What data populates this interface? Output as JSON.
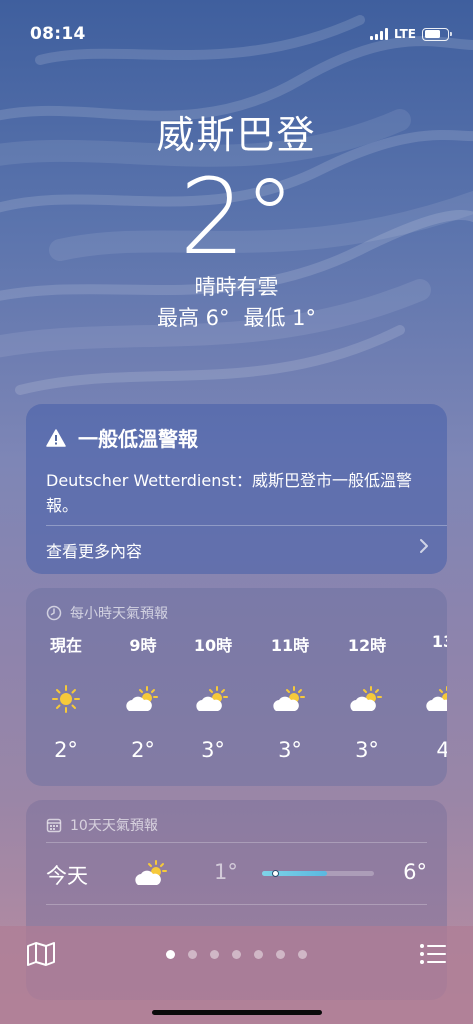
{
  "status_bar": {
    "time": "08:14",
    "network": "LTE",
    "battery_level": 0.7
  },
  "location": {
    "city": "威斯巴登",
    "temperature": "2°",
    "condition": "晴時有雲",
    "high": "最高 6°",
    "low": "最低 1°"
  },
  "alert": {
    "icon": "warning-icon",
    "title": "一般低溫警報",
    "body": "Deutscher Wetterdienst：威斯巴登市一般低溫警報。",
    "more_label": "查看更多內容"
  },
  "hourly": {
    "header": "每小時天氣預報",
    "icon": "clock-icon",
    "items": [
      {
        "time": "現在",
        "icon": "sun-icon",
        "temp": "2°"
      },
      {
        "time": "9時",
        "icon": "partly-cloudy-icon",
        "temp": "2°"
      },
      {
        "time": "10時",
        "icon": "partly-cloudy-icon",
        "temp": "3°"
      },
      {
        "time": "11時",
        "icon": "partly-cloudy-icon",
        "temp": "3°"
      },
      {
        "time": "12時",
        "icon": "partly-cloudy-icon",
        "temp": "3°"
      },
      {
        "time": "13",
        "icon": "partly-cloudy-icon",
        "temp": "4"
      }
    ]
  },
  "daily": {
    "header": "10天天氣預報",
    "icon": "calendar-icon",
    "days": [
      {
        "day": "今天",
        "icon": "partly-cloudy-icon",
        "low": "1°",
        "high": "6°",
        "current_position": 0.12,
        "range_start": 0.0,
        "range_end": 0.58
      }
    ]
  },
  "bottom_bar": {
    "page_count": 7,
    "active_page": 0,
    "map_icon": "map-icon",
    "list_icon": "list-icon"
  },
  "colors": {
    "sun": "#f6c93a",
    "cloud": "#ffffff",
    "range_fill": "#5ab8e0"
  }
}
